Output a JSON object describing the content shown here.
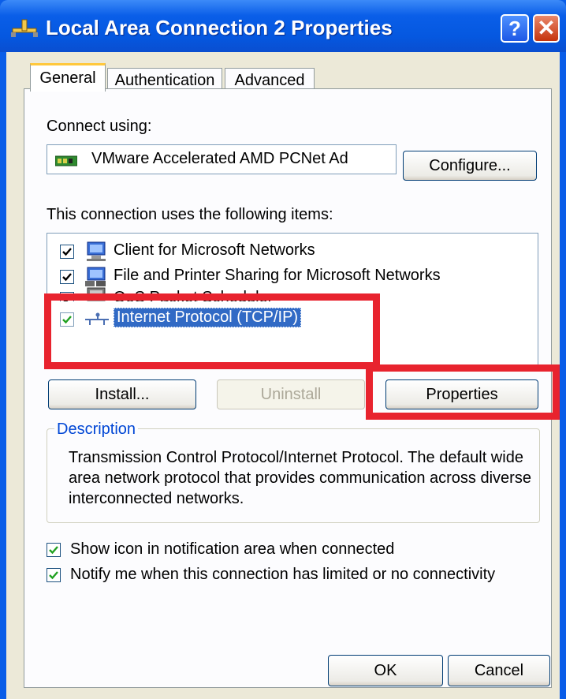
{
  "window": {
    "title": "Local Area Connection 2 Properties",
    "help_label": "?",
    "close_label": "✕"
  },
  "tabs": [
    {
      "label": "General",
      "active": true
    },
    {
      "label": "Authentication",
      "active": false
    },
    {
      "label": "Advanced",
      "active": false
    }
  ],
  "general": {
    "connect_using_label": "Connect using:",
    "adapter_name": "VMware Accelerated AMD PCNet Ad",
    "configure_label": "Configure...",
    "items_label": "This connection uses the following items:",
    "items": [
      {
        "label": "Client for Microsoft Networks",
        "checked": true
      },
      {
        "label": "File and Printer Sharing for Microsoft Networks",
        "checked": true
      },
      {
        "label": "QoS Packet Scheduler",
        "checked": true
      },
      {
        "label": "Internet Protocol (TCP/IP)",
        "checked": true,
        "selected": true
      }
    ],
    "install_label": "Install...",
    "uninstall_label": "Uninstall",
    "properties_label": "Properties",
    "description_legend": "Description",
    "description_text": "Transmission Control Protocol/Internet Protocol. The default wide area network protocol that provides communication across diverse interconnected networks.",
    "show_icon_label": "Show icon in notification area when connected",
    "notify_label": "Notify me when this connection has limited or no connectivity"
  },
  "footer": {
    "ok_label": "OK",
    "cancel_label": "Cancel"
  },
  "colors": {
    "titlebar": "#0a5ee8",
    "face": "#ece9d8",
    "selection": "#316ac5",
    "highlight_box": "#e8232e",
    "legend_text": "#0046d5"
  }
}
